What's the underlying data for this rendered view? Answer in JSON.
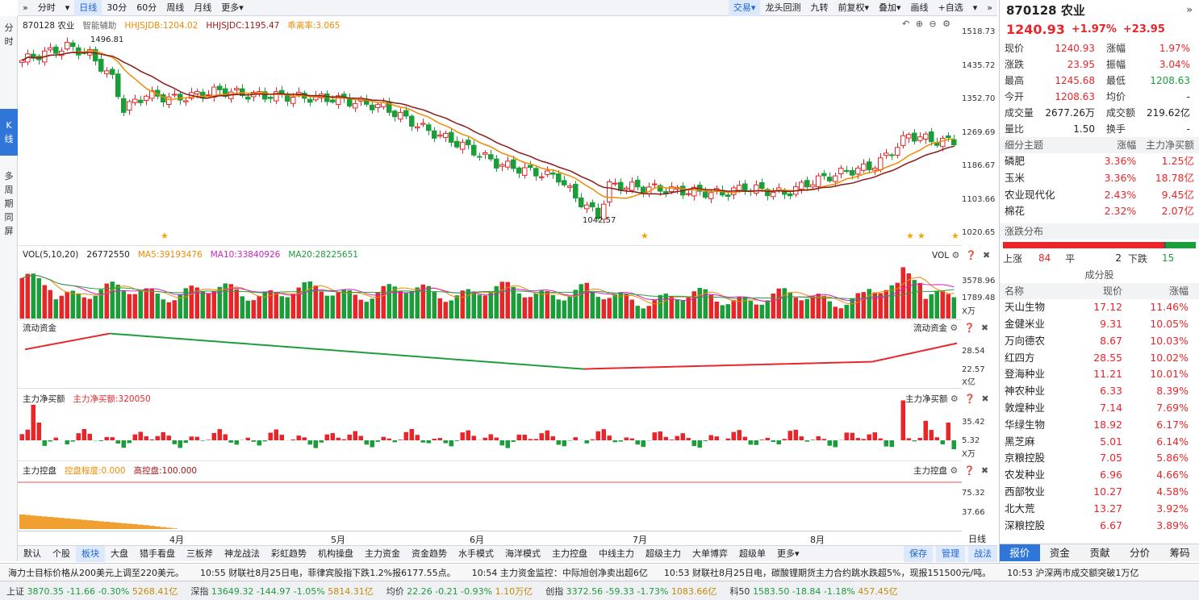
{
  "toolbar": {
    "left": [
      "»",
      "分时",
      "▾",
      "日线",
      "30分",
      "60分",
      "周线",
      "月线",
      "更多▾"
    ],
    "right": [
      "交易▾",
      "龙头回测",
      "九转",
      "前复权▾",
      "叠加▾",
      "画线",
      "+自选",
      "▾",
      "»"
    ]
  },
  "left_tabs": [
    {
      "label": "分\n时",
      "active": false
    },
    {
      "label": "K\n线",
      "active": true
    },
    {
      "label": "多\n周\n期\n同\n屏",
      "active": false
    }
  ],
  "kpanel": {
    "title": "870128 农业",
    "assist": "智能辅助",
    "ind1": "HHJSJDB:1204.02",
    "ind2": "HHJSJDC:1195.47",
    "ind3": "乖离率:3.065",
    "high_label": "1496.81",
    "low_label": "1042.57",
    "icons": "↶ ⊕ ⊖ ⚙",
    "y": [
      "1518.73",
      "1435.72",
      "1352.70",
      "1269.69",
      "1186.67",
      "1103.66",
      "1020.65"
    ]
  },
  "vol": {
    "title": "VOL(5,10,20)",
    "v": "26772550",
    "ma5": "MA5:39193476",
    "ma10": "MA10:33840926",
    "ma20": "MA20:28225651",
    "tag": "VOL",
    "y": [
      "3578.96",
      "1789.48",
      "X万"
    ]
  },
  "flow": {
    "title": "流动资金",
    "tag": "流动资金",
    "y": [
      "28.54",
      "22.57",
      "X亿"
    ]
  },
  "net": {
    "title": "主力净买额",
    "val": "主力净买额:320050",
    "tag": "主力净买额",
    "y": [
      "35.42",
      "5.32",
      "X万"
    ]
  },
  "ctrl": {
    "title": "主力控盘",
    "deg": "控盘程度:0.000",
    "high": "高控盘:100.000",
    "tag": "主力控盘",
    "y": [
      "75.32",
      "37.66"
    ]
  },
  "months": [
    "4月",
    "5月",
    "6月",
    "7月",
    "8月"
  ],
  "daily_tag": "日线",
  "bottom_tabs": [
    "默认",
    "个股",
    "板块",
    "大盘",
    "猎手看盘",
    "三板斧",
    "神龙战法",
    "彩虹趋势",
    "机构操盘",
    "主力资金",
    "资金趋势",
    "水手模式",
    "海洋模式",
    "主力控盘",
    "中线主力",
    "超级主力",
    "大单博弈",
    "超级单",
    "更多▾"
  ],
  "bottom_right": [
    "保存",
    "管理",
    "战法"
  ],
  "news": [
    "海力士目标价格从200美元上调至220美元。",
    "10:55 财联社8月25日电，菲律宾股指下跌1.2%报6177.55点。",
    "10:54 主力资金监控：中际旭创净卖出超6亿",
    "10:53 财联社8月25日电，碳酸锂期货主力合约跳水跌超5%，现报151500元/吨。",
    "10:53 沪深两市成交额突破1万亿"
  ],
  "ticker": [
    {
      "n": "上证",
      "v": "3870.35",
      "c": "-11.66",
      "p": "-0.30%",
      "a": "5268.41亿"
    },
    {
      "n": "深指",
      "v": "13649.32",
      "c": "-144.97",
      "p": "-1.05%",
      "a": "5814.31亿"
    },
    {
      "n": "均价",
      "v": "22.26",
      "c": "-0.21",
      "p": "-0.93%",
      "a": "1.10万亿"
    },
    {
      "n": "创指",
      "v": "3372.56",
      "c": "-59.33",
      "p": "-1.73%",
      "a": "1083.66亿"
    },
    {
      "n": "科50",
      "v": "1583.50",
      "c": "-18.84",
      "p": "-1.18%",
      "a": "457.45亿"
    }
  ],
  "quote": {
    "code": "870128 农业",
    "price": "1240.93",
    "chg": "+1.97%",
    "amt": "+23.95",
    "rows": [
      [
        "现价",
        "1240.93",
        "涨幅",
        "1.97%"
      ],
      [
        "涨跌",
        "23.95",
        "振幅",
        "3.04%"
      ],
      [
        "最高",
        "1245.68",
        "最低",
        "1208.63"
      ],
      [
        "今开",
        "1208.63",
        "均价",
        "-"
      ],
      [
        "成交量",
        "2677.26万",
        "成交额",
        "219.62亿"
      ],
      [
        "量比",
        "1.50",
        "换手",
        "-"
      ]
    ]
  },
  "themes": {
    "h": [
      "细分主题",
      "涨幅",
      "主力净买额"
    ],
    "rows": [
      [
        "磷肥",
        "3.36%",
        "1.25亿"
      ],
      [
        "玉米",
        "3.36%",
        "18.78亿"
      ],
      [
        "农业现代化",
        "2.43%",
        "9.45亿"
      ],
      [
        "棉花",
        "2.32%",
        "2.07亿"
      ]
    ]
  },
  "dist": {
    "title": "涨跌分布",
    "up_l": "上涨",
    "up": "84",
    "flat_l": "平",
    "flat": "2",
    "down_l": "下跌",
    "down": "15",
    "up_ratio": 0.832
  },
  "comp": {
    "title": "成分股",
    "h": [
      "名称",
      "现价",
      "涨幅"
    ],
    "rows": [
      [
        "天山生物",
        "17.12",
        "11.46%"
      ],
      [
        "金健米业",
        "9.31",
        "10.05%"
      ],
      [
        "万向德农",
        "8.67",
        "10.03%"
      ],
      [
        "红四方",
        "28.55",
        "10.02%"
      ],
      [
        "登海种业",
        "11.21",
        "10.01%"
      ],
      [
        "神农种业",
        "6.33",
        "8.39%"
      ],
      [
        "敦煌种业",
        "7.14",
        "7.69%"
      ],
      [
        "华绿生物",
        "18.92",
        "6.17%"
      ],
      [
        "黑芝麻",
        "5.01",
        "6.14%"
      ],
      [
        "京粮控股",
        "7.05",
        "5.86%"
      ],
      [
        "农发种业",
        "6.96",
        "4.66%"
      ],
      [
        "西部牧业",
        "10.27",
        "4.58%"
      ],
      [
        "北大荒",
        "13.27",
        "3.92%"
      ],
      [
        "深粮控股",
        "6.67",
        "3.89%"
      ]
    ]
  },
  "right_tabs": [
    "报价",
    "资金",
    "贡献",
    "分价",
    "筹码"
  ],
  "colors": {
    "up": "#e8262a",
    "down": "#1a9e3a",
    "accent": "#2f76d8"
  }
}
